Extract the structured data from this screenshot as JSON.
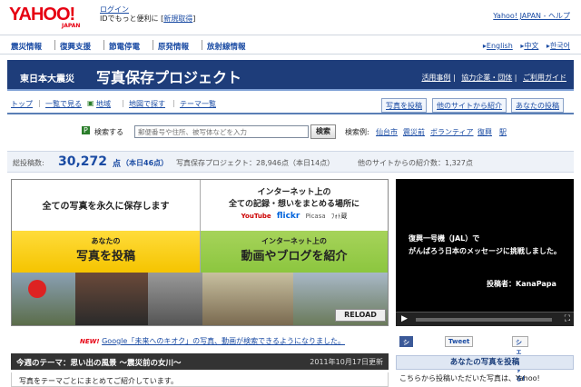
{
  "header": {
    "logo_text": "YAHOO!",
    "logo_sub": "JAPAN",
    "login_label": "ログイン",
    "login_desc": "IDでもっと便利に",
    "register_label": "新規取得",
    "top_links": "Yahoo! JAPAN - ヘルプ"
  },
  "nav": {
    "items": [
      "震災情報",
      "復興支援",
      "節電停電",
      "原発情報",
      "放射線情報"
    ],
    "langs": [
      "English",
      "中文",
      "한국어"
    ]
  },
  "banner": {
    "eyebrow": "東日本大震災",
    "title": "写真保存プロジェクト",
    "links": [
      "活用事例",
      "協力企業・団体",
      "ご利用ガイド"
    ]
  },
  "subnav": {
    "links": [
      "トップ",
      "一覧で見る",
      "地域",
      "地図で探す",
      "テーマ一覧"
    ],
    "tabs": [
      "写真を投稿",
      "他のサイトから紹介",
      "あなたの投稿"
    ]
  },
  "search": {
    "label": "検索する",
    "placeholder": "郵便番号や住所、被写体などを入力",
    "button": "検索",
    "examples_label": "検索例:",
    "examples": [
      "仙台市",
      "震災前",
      "ボランティア",
      "復興",
      "駅"
    ]
  },
  "stats": {
    "total_label": "総投稿数:",
    "total": "30,272",
    "unit": "点",
    "today": "（本日46点）",
    "project": "写真保存プロジェクト：28,946点（本日14点）",
    "other": "他のサイトからの紹介数：1,327点"
  },
  "promo": {
    "top_left": "全ての写真を永久に保存します",
    "top_right_1": "インターネット上の",
    "top_right_2": "全ての記録・想いをまとめる場所に",
    "services": [
      "YouTube",
      "flickr",
      "Picasa",
      "ﾌｫﾄ蔵"
    ],
    "left_sub": "あなたの",
    "left_main": "写真を投稿",
    "right_sub": "インターネット上の",
    "right_main": "動画やブログを紹介",
    "reload": "RELOAD"
  },
  "video": {
    "line1": "復興一号機（JAL）で",
    "line2": "がんばろう日本のメッセージに挑戦しました。",
    "poster": "投稿者：KanaPapa"
  },
  "notice": {
    "badge": "NEW!",
    "text": "Google「未来へのキオク」の写真、動画が検索できるようになりました。"
  },
  "social": {
    "share": "シェア",
    "tweet": "Tweet",
    "yahoo": "シェアする!"
  },
  "theme": {
    "label": "今週のテーマ：思い出の風景 〜震災前の女川〜",
    "date": "2011年10月17日更新",
    "body": "写真をテーマごとにまとめてご紹介しています。"
  },
  "sidebox": {
    "title": "あなたの写真を投稿",
    "body": "こちらから投稿いただいた写真は、Yahoo!"
  },
  "colors": {
    "banner": "#1e3d7a",
    "link": "#1a4ba3",
    "yahoo_red": "#e60012",
    "yellow": "#f5c400",
    "green": "#8cc63f"
  }
}
